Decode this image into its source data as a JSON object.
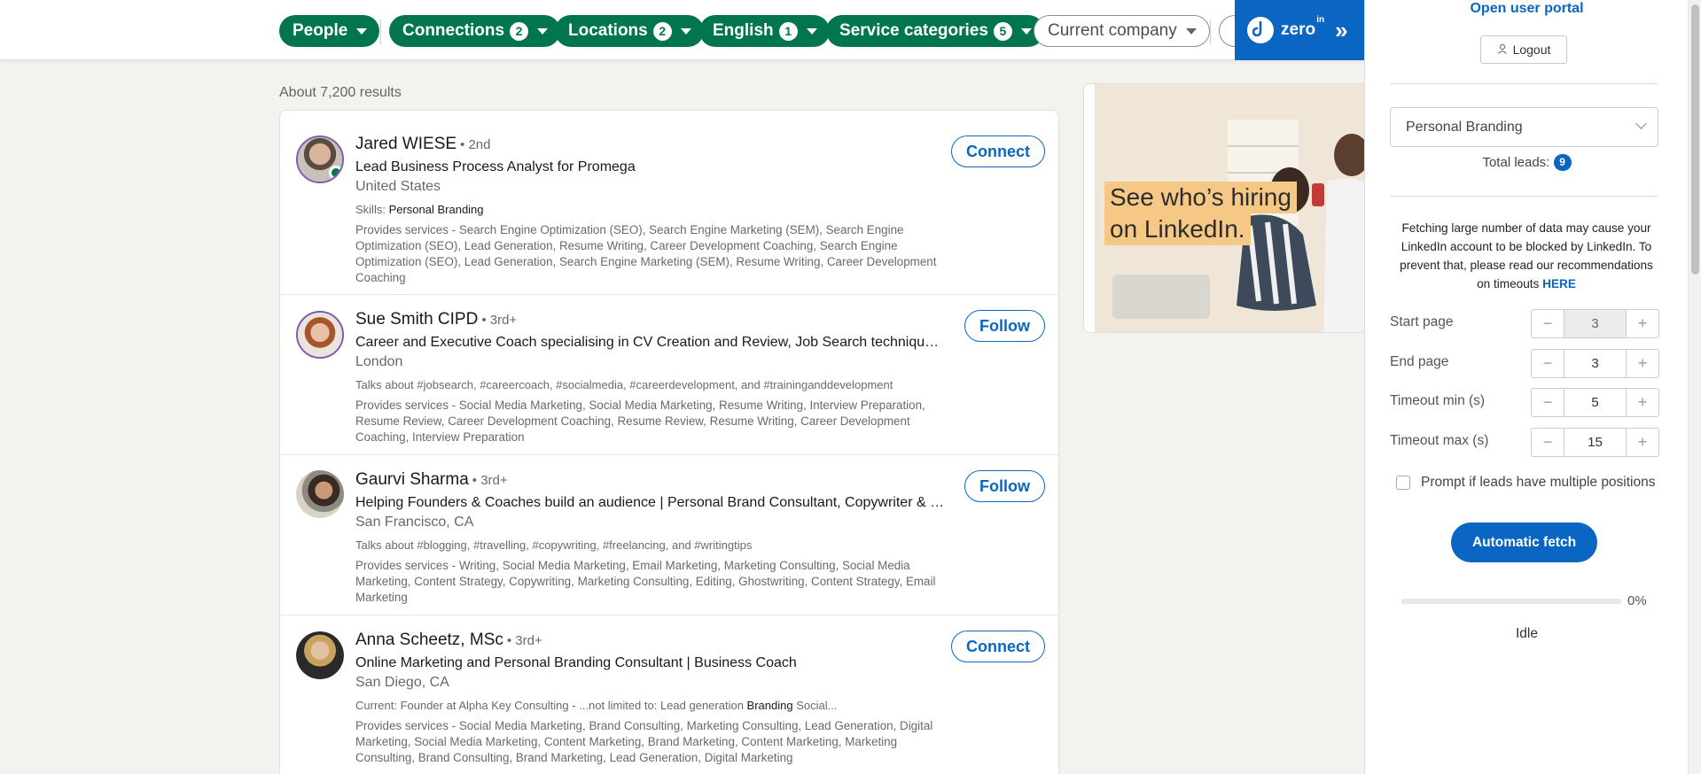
{
  "filters": [
    {
      "label": "People",
      "count": null,
      "active": true
    },
    {
      "label": "Connections",
      "count": "2",
      "active": true
    },
    {
      "label": "Locations",
      "count": "2",
      "active": true
    },
    {
      "label": "English",
      "count": "1",
      "active": true
    },
    {
      "label": "Service categories",
      "count": "5",
      "active": true
    },
    {
      "label": "Current company",
      "count": null,
      "active": false
    }
  ],
  "extension_badge": {
    "brand": "zero",
    "brand_sup": "in",
    "expand_glyph": "»"
  },
  "results": {
    "count_text": "About 7,200 results",
    "items": [
      {
        "name": "Jared WIESE",
        "degree": "• 2nd",
        "headline": "Lead Business Process Analyst for Promega",
        "location": "United States",
        "extra_prefix": "Skills: ",
        "extra_bold": "Personal Branding",
        "extra_suffix": "",
        "services": "Provides services - Search Engine Optimization (SEO), Search Engine Marketing (SEM), Search Engine Optimization (SEO), Lead Generation, Resume Writing, Career Development Coaching, Search Engine Optimization (SEO), Lead Generation, Search Engine Marketing (SEM), Resume Writing, Career Development Coaching",
        "action": "Connect"
      },
      {
        "name": "Sue Smith CIPD",
        "degree": "• 3rd+",
        "headline": "Career and Executive Coach specialising in CV Creation and Review, Job Search techniques, Pe...",
        "location": "London",
        "extra_prefix": "Talks about #jobsearch, #careercoach, #socialmedia, #careerdevelopment, and #traininganddevelopment",
        "extra_bold": "",
        "extra_suffix": "",
        "services": "Provides services - Social Media Marketing, Social Media Marketing, Resume Writing, Interview Preparation, Resume Review, Career Development Coaching, Resume Review, Resume Writing, Career Development Coaching, Interview Preparation",
        "action": "Follow"
      },
      {
        "name": "Gaurvi Sharma",
        "degree": "• 3rd+",
        "headline": "Helping Founders & Coaches build an audience | Personal Brand Consultant, Copywriter & gh...",
        "location": "San Francisco, CA",
        "extra_prefix": "Talks about #blogging, #travelling, #copywriting, #freelancing, and #writingtips",
        "extra_bold": "",
        "extra_suffix": "",
        "services": "Provides services - Writing, Social Media Marketing, Email Marketing, Marketing Consulting, Social Media Marketing, Content Strategy, Copywriting, Marketing Consulting, Editing, Ghostwriting, Content Strategy, Email Marketing",
        "action": "Follow"
      },
      {
        "name": "Anna Scheetz, MSc",
        "degree": "• 3rd+",
        "headline": "Online Marketing and Personal Branding Consultant | Business Coach",
        "location": "San Diego, CA",
        "extra_prefix": "Current: Founder at Alpha Key Consulting - ...not limited to: Lead generation ",
        "extra_bold": "Branding",
        "extra_suffix": " Social...",
        "services": "Provides services - Social Media Marketing, Brand Consulting, Marketing Consulting, Lead Generation, Digital Marketing, Social Media Marketing, Content Marketing, Brand Marketing, Content Marketing, Marketing Consulting, Brand Consulting, Brand Marketing, Lead Generation, Digital Marketing",
        "action": "Connect"
      }
    ]
  },
  "ad": {
    "line1": "See who’s hiring",
    "line2": "on LinkedIn."
  },
  "panel": {
    "portal_link": "Open user portal",
    "logout": "Logout",
    "list_select": "Personal Branding",
    "total_leads_label": "Total leads:",
    "total_leads": "9",
    "warning": "Fetching large number of data may cause your LinkedIn account to be blocked by LinkedIn. To prevent that, please read our recommendations on timeouts",
    "warning_link": "HERE",
    "fields": [
      {
        "label": "Start page",
        "value": "3"
      },
      {
        "label": "End page",
        "value": "3"
      },
      {
        "label": "Timeout min (s)",
        "value": "5"
      },
      {
        "label": "Timeout max (s)",
        "value": "15"
      }
    ],
    "minus": "−",
    "plus": "+",
    "checkbox_label": "Prompt if leads have multiple positions",
    "fetch_button": "Automatic fetch",
    "progress_percent": 0,
    "progress_text": "0%",
    "status": "Idle"
  },
  "colors": {
    "linkedin_green": "#01754f",
    "linkedin_blue": "#0a66c2"
  }
}
